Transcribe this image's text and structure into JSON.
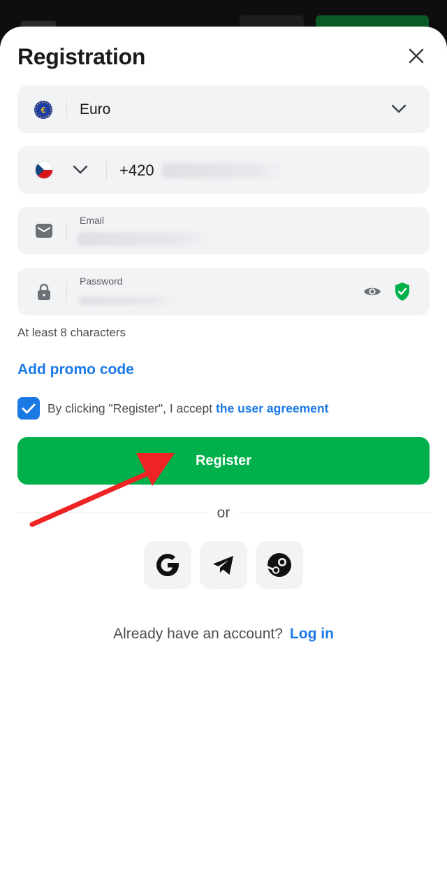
{
  "header": {
    "title": "Registration"
  },
  "form": {
    "currency": {
      "symbol": "€",
      "label": "Euro"
    },
    "phone": {
      "country_code": "+420"
    },
    "email": {
      "label": "Email"
    },
    "password": {
      "label": "Password",
      "hint": "At least 8 characters"
    },
    "promo_label": "Add promo code",
    "agreement": {
      "checked": true,
      "text": "By clicking \"Register\", I accept ",
      "link": "the user agreement"
    },
    "register_label": "Register"
  },
  "social": {
    "or_label": "or",
    "providers": [
      "google-icon",
      "telegram-icon",
      "steam-icon"
    ]
  },
  "footer": {
    "prompt": "Already have an account?",
    "login_label": "Log in"
  },
  "colors": {
    "accent_green": "#00b04b",
    "link_blue": "#1b79e6",
    "field_bg": "#f2f3f5",
    "annotation_red": "#ee2323"
  }
}
